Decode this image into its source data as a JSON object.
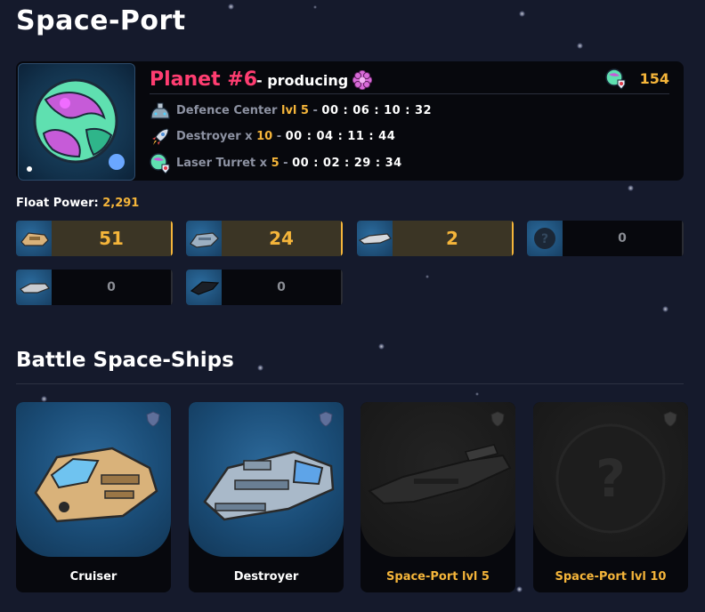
{
  "page": {
    "title": "Space-Port"
  },
  "planet": {
    "name": "Planet #6",
    "status": "- producing",
    "resource_count": "154",
    "production": [
      {
        "icon": "defence-center-icon",
        "name": "Defence Center",
        "qty_prefix": "lvl",
        "qty": "5",
        "sep": "-",
        "timer": "00 : 06 : 10 : 32"
      },
      {
        "icon": "rocket-icon",
        "name": "Destroyer",
        "qty_prefix": "x",
        "qty": "10",
        "sep": "-",
        "timer": "00 : 04 : 11 : 44"
      },
      {
        "icon": "laser-turret-icon",
        "name": "Laser Turret",
        "qty_prefix": "x",
        "qty": "5",
        "sep": "-",
        "timer": "00 : 02 : 29 : 34"
      }
    ]
  },
  "float_power": {
    "label": "Float Power:",
    "value": "2,291"
  },
  "fleet": [
    {
      "ship": "cruiser",
      "count": "51",
      "active": true
    },
    {
      "ship": "destroyer",
      "count": "24",
      "active": true
    },
    {
      "ship": "frigate",
      "count": "2",
      "active": true
    },
    {
      "ship": "unknown",
      "count": "0",
      "active": false
    },
    {
      "ship": "corvette",
      "count": "0",
      "active": false
    },
    {
      "ship": "stealth",
      "count": "0",
      "active": false
    }
  ],
  "battle": {
    "title": "Battle Space-Ships",
    "ships": [
      {
        "name": "Cruiser",
        "locked": false
      },
      {
        "name": "Destroyer",
        "locked": false
      },
      {
        "name": "Space-Port lvl 5",
        "locked": true
      },
      {
        "name": "Space-Port lvl 10",
        "locked": true
      }
    ]
  },
  "colors": {
    "background": "#151a2c",
    "card": "#07080d",
    "accent_gold": "#f5b53a",
    "planet_pink": "#ff3d71",
    "active_count_bg": "#3b3525"
  }
}
